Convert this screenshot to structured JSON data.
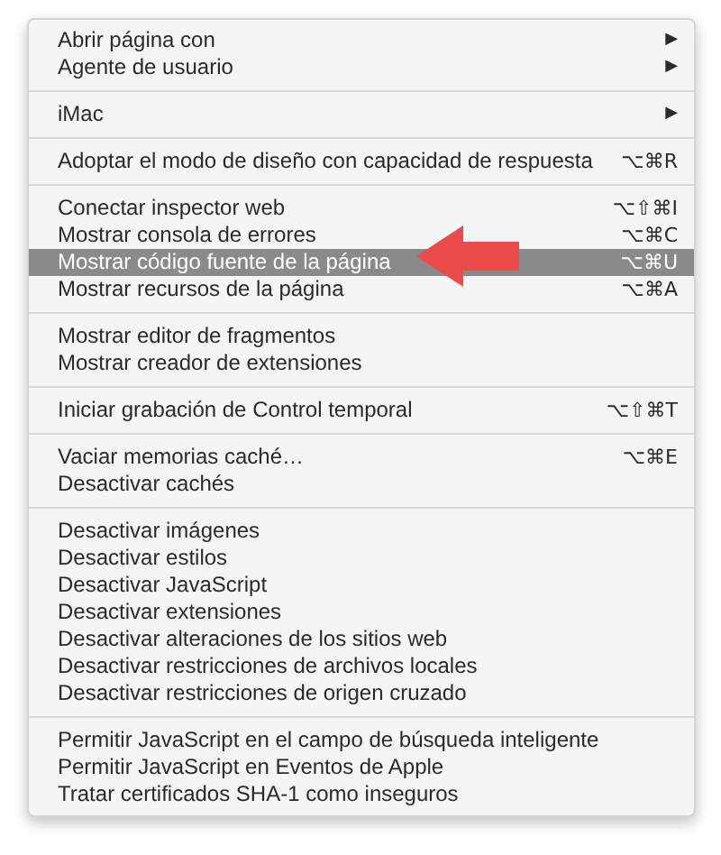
{
  "menu": {
    "sections": [
      {
        "items": [
          {
            "label": "Abrir página con",
            "arrow": "▶",
            "selected": false
          },
          {
            "label": "Agente de usuario",
            "arrow": "▶",
            "selected": false
          }
        ]
      },
      {
        "items": [
          {
            "label": "iMac",
            "arrow": "▶",
            "selected": false
          }
        ]
      },
      {
        "items": [
          {
            "label": "Adoptar el modo de diseño con capacidad de respuesta",
            "shortcut": "⌥⌘R",
            "selected": false
          }
        ]
      },
      {
        "items": [
          {
            "label": "Conectar inspector web",
            "shortcut": "⌥⇧⌘I",
            "selected": false
          },
          {
            "label": "Mostrar consola de errores",
            "shortcut": "⌥⌘C",
            "selected": false
          },
          {
            "label": "Mostrar código fuente de la página",
            "shortcut": "⌥⌘U",
            "selected": true
          },
          {
            "label": "Mostrar recursos de la página",
            "shortcut": "⌥⌘A",
            "selected": false
          }
        ]
      },
      {
        "items": [
          {
            "label": "Mostrar editor de fragmentos",
            "selected": false
          },
          {
            "label": "Mostrar creador de extensiones",
            "selected": false
          }
        ]
      },
      {
        "items": [
          {
            "label": "Iniciar grabación de Control temporal",
            "shortcut": "⌥⇧⌘T",
            "selected": false
          }
        ]
      },
      {
        "items": [
          {
            "label": "Vaciar memorias caché…",
            "shortcut": "⌥⌘E",
            "selected": false
          },
          {
            "label": "Desactivar cachés",
            "selected": false
          }
        ]
      },
      {
        "items": [
          {
            "label": "Desactivar imágenes",
            "selected": false
          },
          {
            "label": "Desactivar estilos",
            "selected": false
          },
          {
            "label": "Desactivar JavaScript",
            "selected": false
          },
          {
            "label": "Desactivar extensiones",
            "selected": false
          },
          {
            "label": "Desactivar alteraciones de los sitios web",
            "selected": false
          },
          {
            "label": "Desactivar restricciones de archivos locales",
            "selected": false
          },
          {
            "label": "Desactivar restricciones de origen cruzado",
            "selected": false
          }
        ]
      },
      {
        "items": [
          {
            "label": "Permitir JavaScript en el campo de búsqueda inteligente",
            "selected": false
          },
          {
            "label": "Permitir JavaScript en Eventos de Apple",
            "selected": false
          },
          {
            "label": "Tratar certificados SHA-1 como inseguros",
            "selected": false
          }
        ]
      }
    ]
  }
}
